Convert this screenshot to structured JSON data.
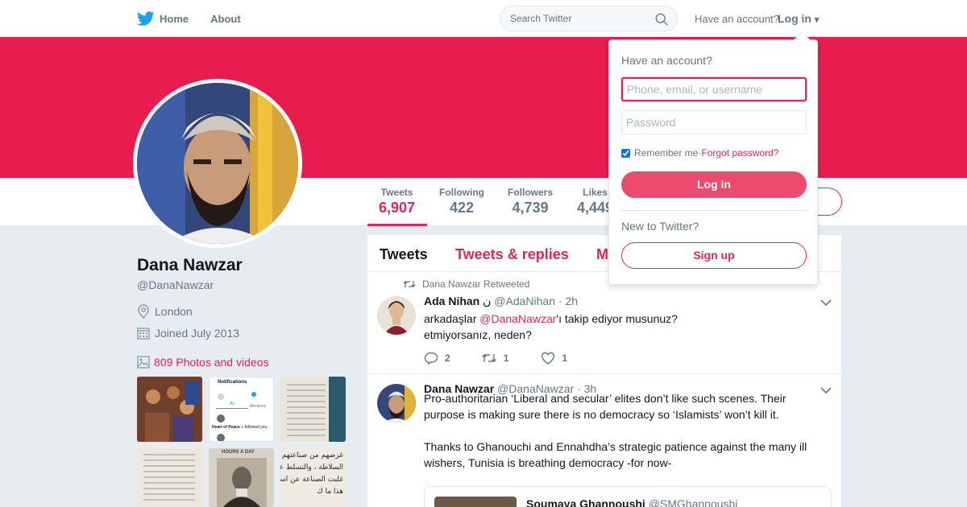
{
  "nav": {
    "home_label": "Home",
    "about_label": "About",
    "search_placeholder": "Search Twitter",
    "have_account": "Have an account?",
    "login_label": "Log in",
    "login_caret": "▾"
  },
  "colors": {
    "brand": "#e81c4f",
    "accent": "#e0245e",
    "twitter_blue": "#1da1f2"
  },
  "profile": {
    "name": "Dana Nawzar",
    "handle": "@DanaNawzar",
    "location": "London",
    "joined": "Joined July 2013",
    "photos_label": "809 Photos and videos"
  },
  "stats": [
    {
      "label": "Tweets",
      "value": "6,907"
    },
    {
      "label": "Following",
      "value": "422"
    },
    {
      "label": "Followers",
      "value": "4,739"
    },
    {
      "label": "Likes",
      "value": "4,449"
    }
  ],
  "tabs": [
    "Tweets",
    "Tweets & replies",
    "Media"
  ],
  "thumbs": {
    "notifications_title": "Notifications",
    "all": "All",
    "mentions": "Mentions",
    "row1": "Heart of Peace",
    "row1b": "followed you",
    "book_title": "HOURS A DAY",
    "arabic1": "غرضهم من صناعتهم الشر",
    "arabic2": "السلاطة ، والتسلط على",
    "arabic3": "غلبت الصناعة عن استد",
    "arabic4": "هذا ما ك"
  },
  "tweets": [
    {
      "retweeted_by": "Dana Nawzar Retweeted",
      "name": "Ada Nihan",
      "name_suffix": "ن",
      "handle": "@AdaNihan",
      "time": "· 2h",
      "text_before": "arkadaşlar ",
      "mention": "@DanaNawzar",
      "text_after": "'ı takip ediyor musunuz?",
      "line2": "etmiyorsanız, neden?",
      "replies": "2",
      "retweets": "1",
      "likes": "1"
    },
    {
      "name": "Dana Nawzar",
      "handle": "@DanaNawzar",
      "time": "· 3h",
      "para1": "Pro-authoritarian ‘Liberal and secular’ elites don’t like such scenes. Their purpose  is making sure there is no democracy so ‘Islamists’ won’t kill it.",
      "para2": "Thanks to Ghanouchi and Ennahdha’s strategic patience against the many ill wishers, Tunisia is breathing democracy -for now-",
      "quote_name": "Soumaya Ghannoushi",
      "quote_handle": "@SMGhannoushi"
    }
  ],
  "login": {
    "title": "Have an account?",
    "username_placeholder": "Phone, email, or username",
    "password_placeholder": "Password",
    "remember": "Remember me",
    "separator": " · ",
    "forgot": "Forgot password?",
    "login_button": "Log in",
    "new_to": "New to Twitter?",
    "signup_button": "Sign up"
  }
}
